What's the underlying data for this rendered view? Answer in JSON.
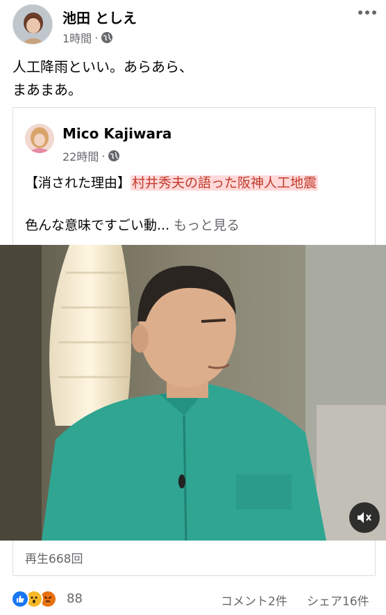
{
  "post": {
    "author": "池田 としえ",
    "time": "1時間",
    "dot": "·",
    "text": "人工降雨といい。あらあら、\nまあまあ。"
  },
  "shared": {
    "author": "Mico Kajiwara",
    "time": "22時間",
    "dot": "·",
    "title_prefix": "【消された理由】",
    "title_link": "村井秀夫の語った阪神人工地震",
    "body": "色んな意味ですごい動...",
    "see_more": "もっと見る"
  },
  "video": {
    "views": "再生668回",
    "mute_icon": "speaker-muted-icon"
  },
  "footer": {
    "reaction_count": "88",
    "comments": "コメント2件",
    "shares": "シェア16件",
    "reaction_types": [
      "like",
      "wow",
      "angry"
    ]
  },
  "colors": {
    "link_highlight_bg": "#ffd9d9",
    "link_highlight_text": "#c0392b",
    "secondary_text": "#65676b",
    "like_blue": "#1877f2"
  }
}
